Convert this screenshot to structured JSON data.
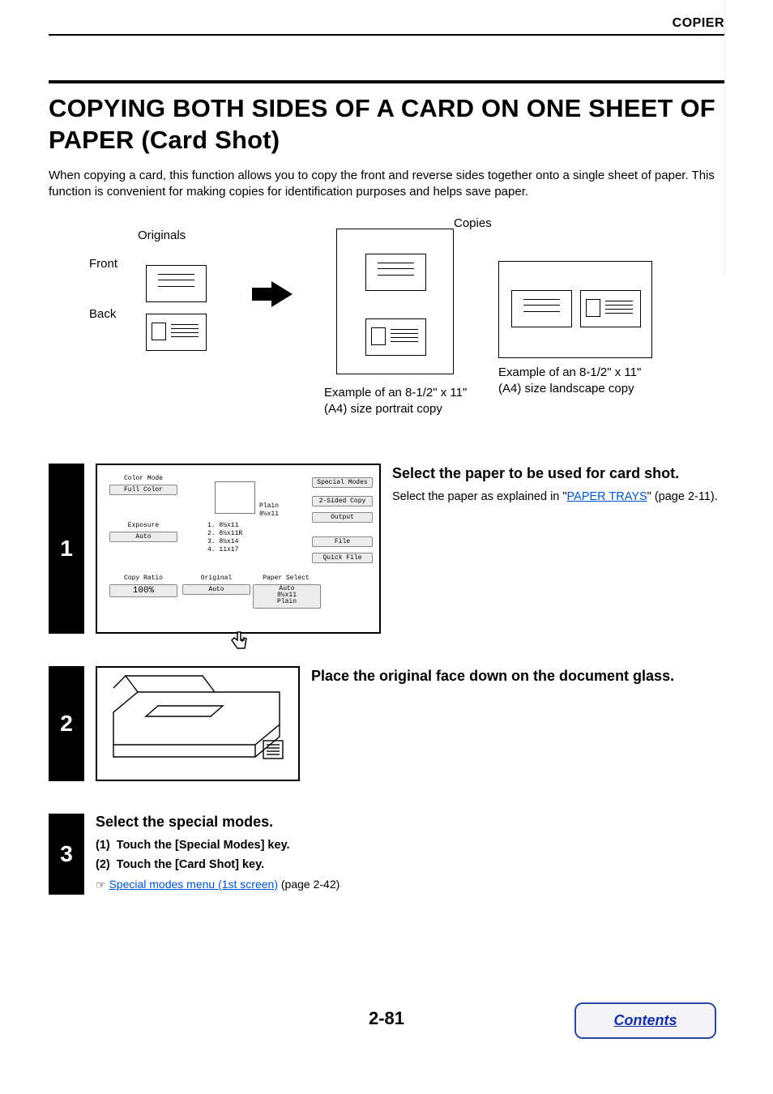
{
  "header": {
    "section": "COPIER"
  },
  "title": "COPYING BOTH SIDES OF A CARD ON ONE SHEET OF PAPER (Card Shot)",
  "intro": "When copying a card, this function allows you to copy the front and reverse sides together onto a single sheet of paper. This function is convenient for making copies for identification purposes and helps save paper.",
  "illus": {
    "originals_label": "Originals",
    "front_label": "Front",
    "back_label": "Back",
    "copies_label": "Copies",
    "portrait_caption": "Example of an 8-1/2\" x 11\" (A4) size portrait copy",
    "landscape_caption": "Example of an 8-1/2\" x 11\" (A4) size landscape copy"
  },
  "panel": {
    "color_mode": "Color Mode",
    "full_color": "Full Color",
    "exposure": "Exposure",
    "auto": "Auto",
    "copy_ratio": "Copy Ratio",
    "ratio_val": "100%",
    "original": "Original",
    "paper_select": "Paper Select",
    "tray_plain1": "Plain",
    "tray_plain2": "8½x11",
    "tray1": "1. 8½x11",
    "tray2": "2. 8½x11R",
    "tray3": "3. 8½x14",
    "tray4": "4. 11x17",
    "special_modes": "Special Modes",
    "two_sided": "2-Sided Copy",
    "output": "Output",
    "file": "File",
    "quick_file": "Quick File",
    "ps_auto": "Auto",
    "ps_size": "8½x11",
    "ps_type": "Plain"
  },
  "steps": {
    "s1": {
      "num": "1",
      "title": "Select the paper to be used for card shot.",
      "text_pre": "Select the paper as explained in \"",
      "link": "PAPER TRAYS",
      "text_post": "\" (page 2-11)."
    },
    "s2": {
      "num": "2",
      "title": "Place the original face down on the document glass."
    },
    "s3": {
      "num": "3",
      "title": "Select the special modes.",
      "item1_num": "(1)",
      "item1": "Touch the [Special Modes] key.",
      "item2_num": "(2)",
      "item2": "Touch the [Card Shot] key.",
      "ref_link": "Special modes menu (1st screen)",
      "ref_post": " (page 2-42)"
    }
  },
  "page_number": "2-81",
  "contents_label": "Contents"
}
